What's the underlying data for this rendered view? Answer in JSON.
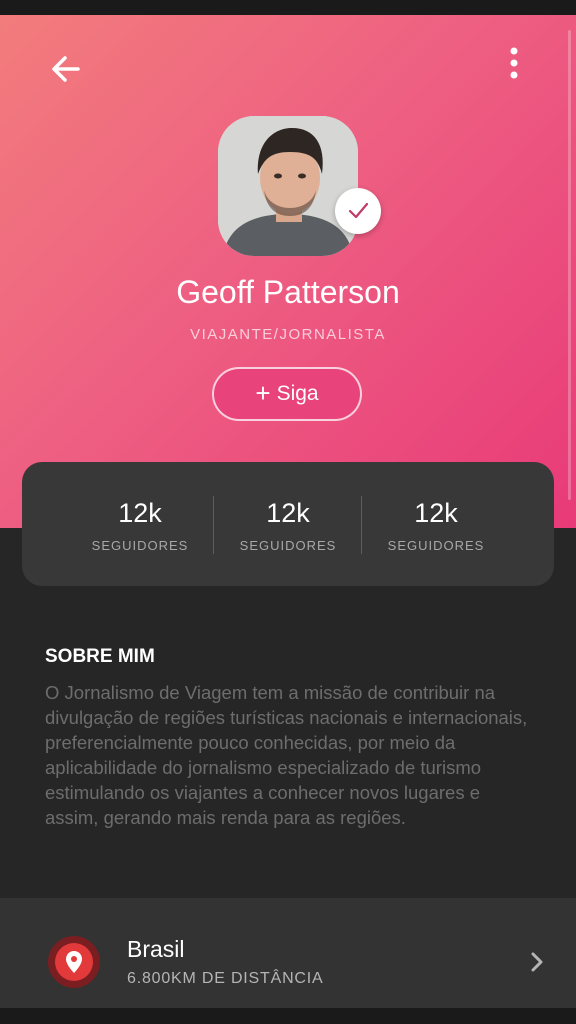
{
  "profile": {
    "name": "Geoff Patterson",
    "role": "VIAJANTE/JORNALISTA",
    "follow_label": "Siga"
  },
  "stats": [
    {
      "value": "12k",
      "label": "SEGUIDORES"
    },
    {
      "value": "12k",
      "label": "SEGUIDORES"
    },
    {
      "value": "12k",
      "label": "SEGUIDORES"
    }
  ],
  "about": {
    "title": "SOBRE MIM",
    "text": "O Jornalismo de Viagem tem a missão de contribuir na divulgação de regiões turísticas nacionais e internacionais, preferencialmente pouco conhecidas, por meio da aplicabilidade do jornalismo especializado de turismo estimulando os viajantes a conhecer novos lugares e assim, gerando mais renda para as regiões."
  },
  "location": {
    "name": "Brasil",
    "distance": "6.800KM DE DISTÂNCIA"
  },
  "icons": {
    "back": "arrow-left-icon",
    "menu": "more-vertical-icon",
    "verified": "check-icon",
    "follow": "plus-icon",
    "location": "map-pin-icon",
    "chevron": "chevron-right-icon"
  },
  "colors": {
    "gradient_start": "#f27c7c",
    "gradient_end": "#e83a78",
    "accent": "#e8437b",
    "background": "#262626",
    "card": "#383838",
    "location_icon": "#e23a3a"
  }
}
